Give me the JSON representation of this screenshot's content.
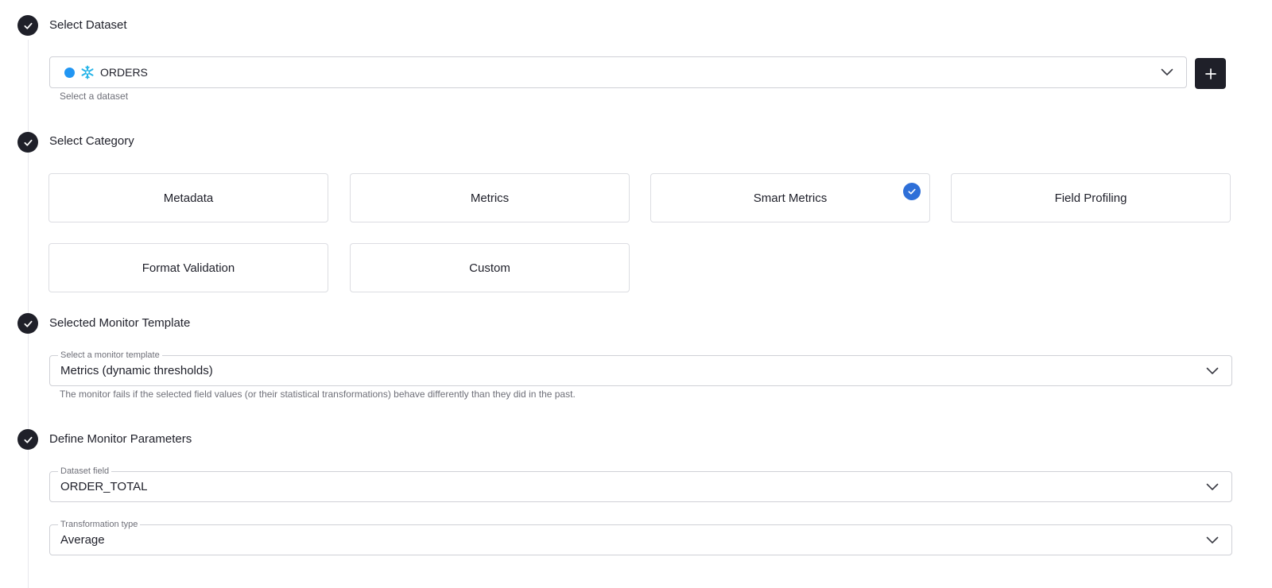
{
  "steps": {
    "dataset": {
      "title": "Select Dataset",
      "value": "ORDERS",
      "helper": "Select a dataset",
      "add_label": "+"
    },
    "category": {
      "title": "Select Category",
      "cards": [
        {
          "label": "Metadata",
          "selected": false
        },
        {
          "label": "Metrics",
          "selected": false
        },
        {
          "label": "Smart Metrics",
          "selected": true
        },
        {
          "label": "Field Profiling",
          "selected": false
        },
        {
          "label": "Format Validation",
          "selected": false
        },
        {
          "label": "Custom",
          "selected": false
        }
      ]
    },
    "template": {
      "title": "Selected Monitor Template",
      "label": "Select a monitor template",
      "value": "Metrics (dynamic thresholds)",
      "helper": "The monitor fails if the selected field values (or their statistical transformations) behave differently than they did in the past."
    },
    "parameters": {
      "title": "Define Monitor Parameters",
      "dataset_field": {
        "label": "Dataset field",
        "value": "ORDER_TOTAL"
      },
      "transformation": {
        "label": "Transformation type",
        "value": "Average"
      }
    }
  },
  "colors": {
    "accent_dark": "#1f2029",
    "selected_check": "#2e6fd8",
    "dataset_dot": "#2196f3",
    "snowflake": "#29b5e8"
  },
  "icons": {
    "step_complete": "check-icon",
    "dropdown": "chevron-down-icon",
    "source": "snowflake-icon"
  }
}
